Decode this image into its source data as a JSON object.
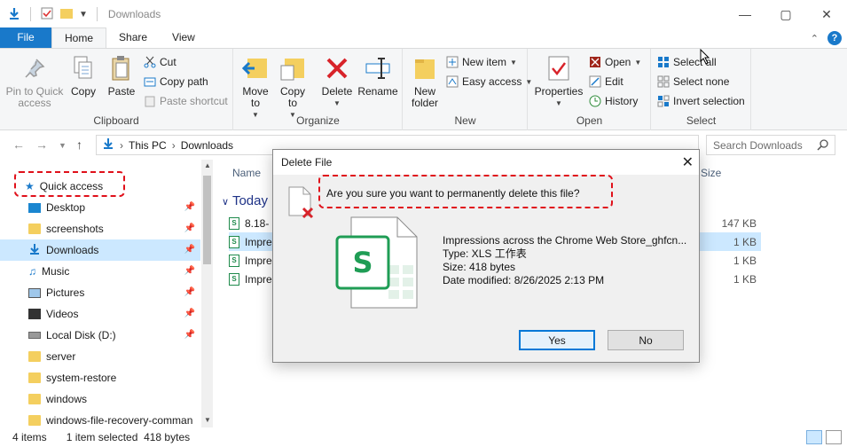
{
  "window": {
    "title": "Downloads",
    "minimize": "—",
    "maximize": "▢",
    "close": "✕"
  },
  "ribbon_tabs": [
    {
      "label": "File"
    },
    {
      "label": "Home"
    },
    {
      "label": "Share"
    },
    {
      "label": "View"
    }
  ],
  "ribbon": {
    "clipboard": {
      "label": "Clipboard",
      "pin": "Pin to Quick access",
      "copy": "Copy",
      "paste": "Paste",
      "cut": "Cut",
      "copy_path": "Copy path",
      "paste_shortcut": "Paste shortcut"
    },
    "organize": {
      "label": "Organize",
      "move_to": "Move to",
      "copy_to": "Copy to",
      "delete": "Delete",
      "rename": "Rename"
    },
    "new": {
      "label": "New",
      "new_folder": "New folder",
      "new_item": "New item",
      "easy_access": "Easy access"
    },
    "open": {
      "label": "Open",
      "properties": "Properties",
      "open": "Open",
      "edit": "Edit",
      "history": "History"
    },
    "select": {
      "label": "Select",
      "select_all": "Select all",
      "select_none": "Select none",
      "invert": "Invert selection"
    }
  },
  "address": {
    "crumbs": [
      "This PC",
      "Downloads"
    ],
    "search_placeholder": "Search Downloads"
  },
  "nav": {
    "items": [
      {
        "label": "Quick access",
        "pinned": false
      },
      {
        "label": "Desktop",
        "pinned": true
      },
      {
        "label": "screenshots",
        "pinned": true
      },
      {
        "label": "Downloads",
        "pinned": true
      },
      {
        "label": "Music",
        "pinned": true
      },
      {
        "label": "Pictures",
        "pinned": true
      },
      {
        "label": "Videos",
        "pinned": true
      },
      {
        "label": "Local Disk (D:)",
        "pinned": true
      },
      {
        "label": "server",
        "pinned": false
      },
      {
        "label": "system-restore",
        "pinned": false
      },
      {
        "label": "windows",
        "pinned": false
      },
      {
        "label": "windows-file-recovery-comman",
        "pinned": false
      }
    ]
  },
  "files": {
    "col_name": "Name",
    "col_size": "Size",
    "group": "Today",
    "rows": [
      {
        "name": "8.18-",
        "size": "147 KB"
      },
      {
        "name": "Impre",
        "size": "1 KB"
      },
      {
        "name": "Impre",
        "size": "1 KB"
      },
      {
        "name": "Impre",
        "size": "1 KB"
      }
    ]
  },
  "status": {
    "items": "4 items",
    "selected": "1 item selected",
    "size": "418 bytes"
  },
  "dialog": {
    "title": "Delete File",
    "question": "Are you sure you want to permanently delete this file?",
    "file_name": "Impressions across the Chrome Web Store_ghfcn...",
    "file_type": "Type: XLS 工作表",
    "file_size": "Size: 418 bytes",
    "file_date": "Date modified: 8/26/2025 2:13 PM",
    "yes": "Yes",
    "no": "No"
  },
  "colors": {
    "accent": "#1979ca",
    "highlight": "#e0101a",
    "selection": "#cce8ff",
    "sheet_green": "#1f8a4c"
  }
}
